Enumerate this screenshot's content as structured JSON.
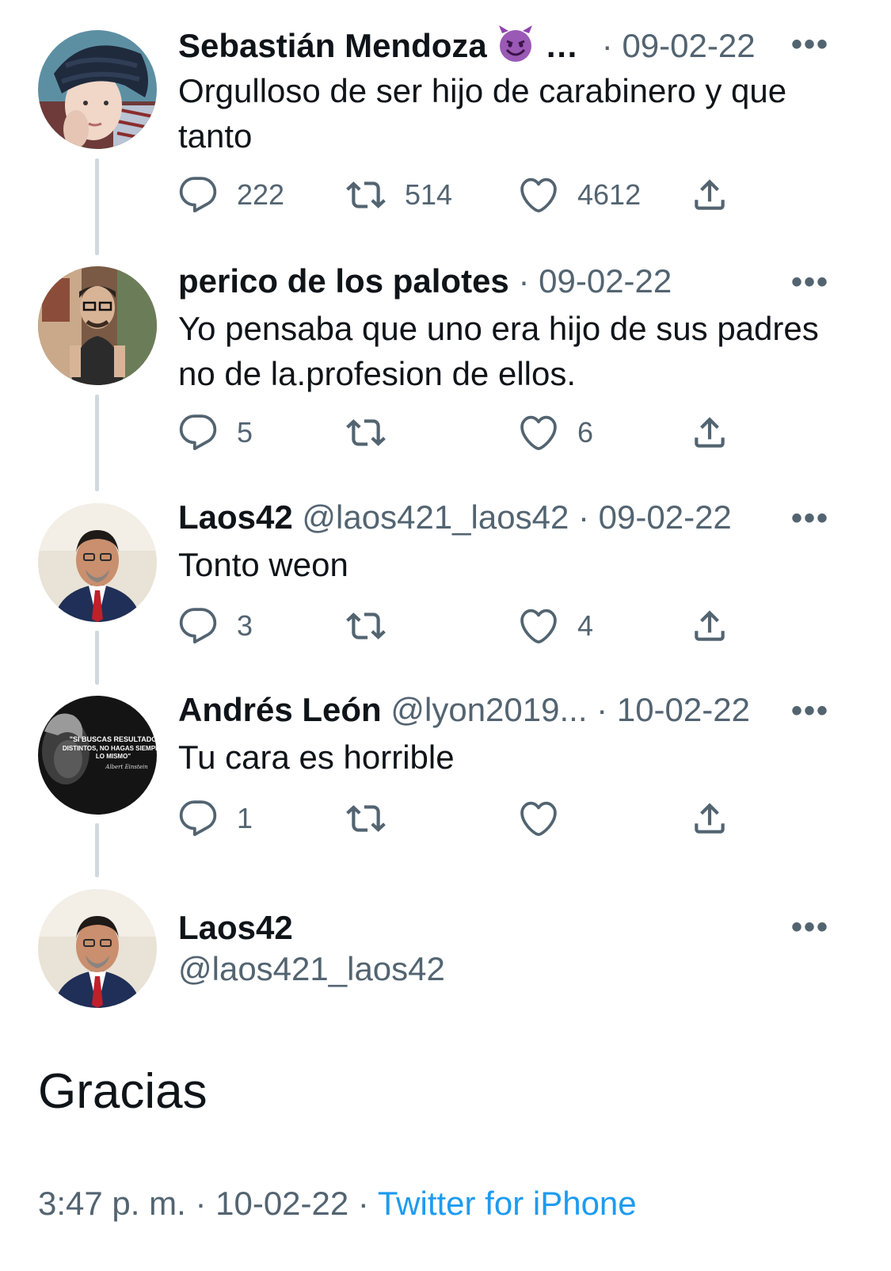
{
  "thread": [
    {
      "name": "Sebastián Mendoza",
      "emoji_icon": "smiling-devil-emoji",
      "ellipsis": "…",
      "handle": "",
      "dot": "·",
      "date": "09-02-22",
      "more": "•••",
      "text": "Orgulloso de ser hijo de carabinero y que tanto",
      "replies": "222",
      "retweets": "514",
      "likes": "4612"
    },
    {
      "name": "perico de los palotes",
      "handle": "",
      "dot": "·",
      "date": "09-02-22",
      "more": "•••",
      "text": "Yo pensaba que uno era hijo de sus padres no de la.profesion de ellos.",
      "replies": "5",
      "retweets": "",
      "likes": "6"
    },
    {
      "name": "Laos42",
      "handle": "@laos421_laos42",
      "dot": "·",
      "date": "09-02-22",
      "more": "•••",
      "text": "Tonto weon",
      "replies": "3",
      "retweets": "",
      "likes": "4"
    },
    {
      "name": "Andrés León",
      "handle": "@lyon2019...",
      "dot": "·",
      "date": "10-02-22",
      "more": "•••",
      "text": "Tu cara es horrible",
      "replies": "1",
      "retweets": "",
      "likes": ""
    }
  ],
  "main_tweet": {
    "name": "Laos42",
    "handle": "@laos421_laos42",
    "more": "•••",
    "text": "Gracias",
    "time": "3:47 p. m.",
    "dot1": "·",
    "date": "10-02-22",
    "dot2": "·",
    "source": "Twitter for iPhone"
  },
  "avatar_quote": {
    "line1": "\"SI BUSCAS RESULTADOS",
    "line2": "DISTINTOS, NO HAGAS SIEMPRE",
    "line3": "LO MISMO\"",
    "signature": "Albert Einstein"
  },
  "colors": {
    "text": "#0f1419",
    "secondary": "#536471",
    "link": "#1d9bf0",
    "thread_line": "#cfd9de"
  },
  "icons": [
    "reply-icon",
    "retweet-icon",
    "like-icon",
    "share-icon",
    "more-icon"
  ]
}
